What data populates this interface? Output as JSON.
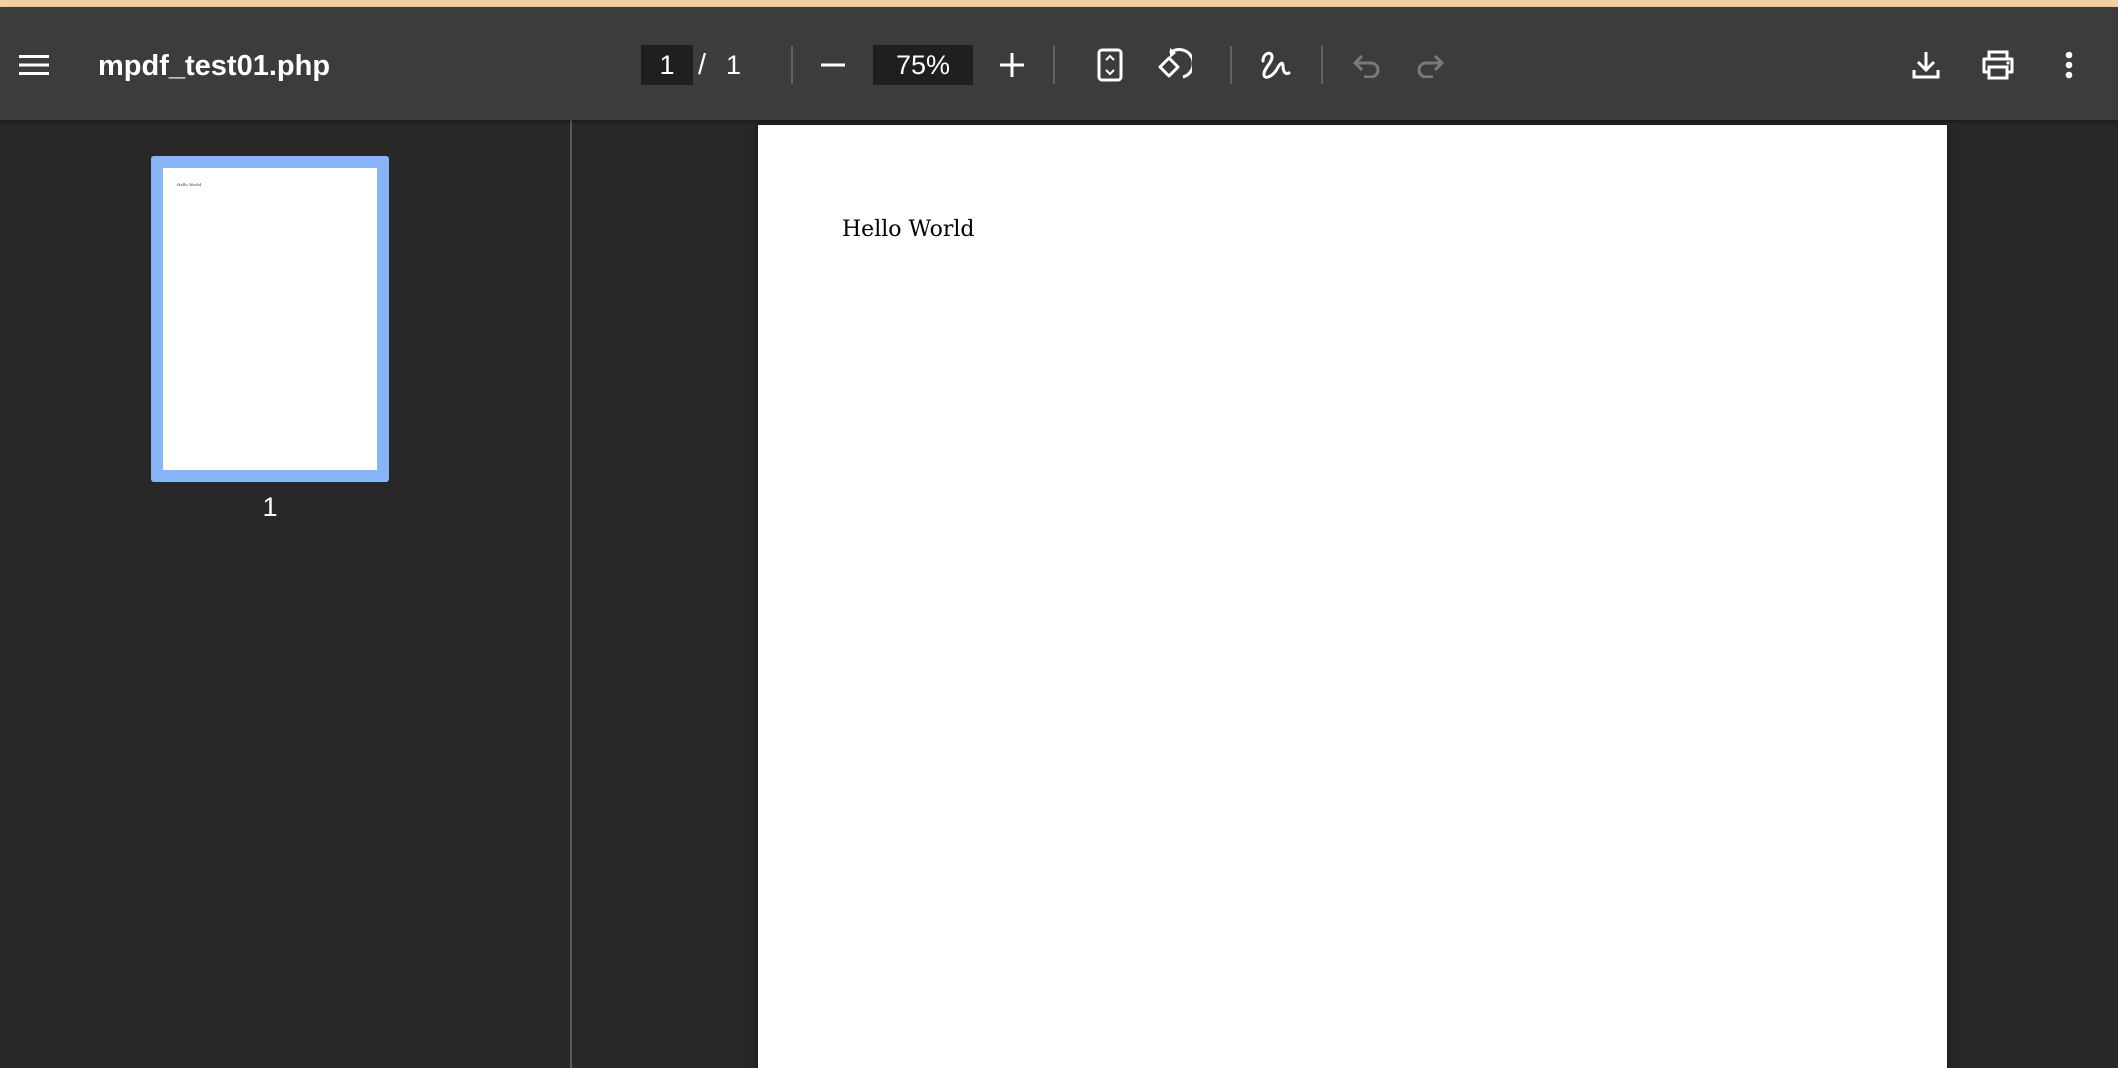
{
  "window": {
    "accent_strip_color": "#f5cfa0"
  },
  "toolbar": {
    "menu_icon": "hamburger-menu-icon",
    "title": "mpdf_test01.php",
    "page_current": "1",
    "page_separator": "/",
    "page_total": "1",
    "zoom_out_icon": "minus-icon",
    "zoom_value": "75%",
    "zoom_in_icon": "plus-icon",
    "fit_page_icon": "fit-to-page-icon",
    "rotate_icon": "rotate-counterclockwise-icon",
    "annotate_icon": "draw-annotation-icon",
    "undo_icon": "undo-icon",
    "redo_icon": "redo-icon",
    "download_icon": "download-icon",
    "print_icon": "print-icon",
    "more_icon": "more-vertical-icon"
  },
  "sidebar": {
    "thumbnails": [
      {
        "page_label": "1",
        "preview_text": "Hello World",
        "selected": true
      }
    ],
    "selection_color": "#8ab4f8"
  },
  "document": {
    "pages": [
      {
        "text": "Hello World"
      }
    ]
  }
}
